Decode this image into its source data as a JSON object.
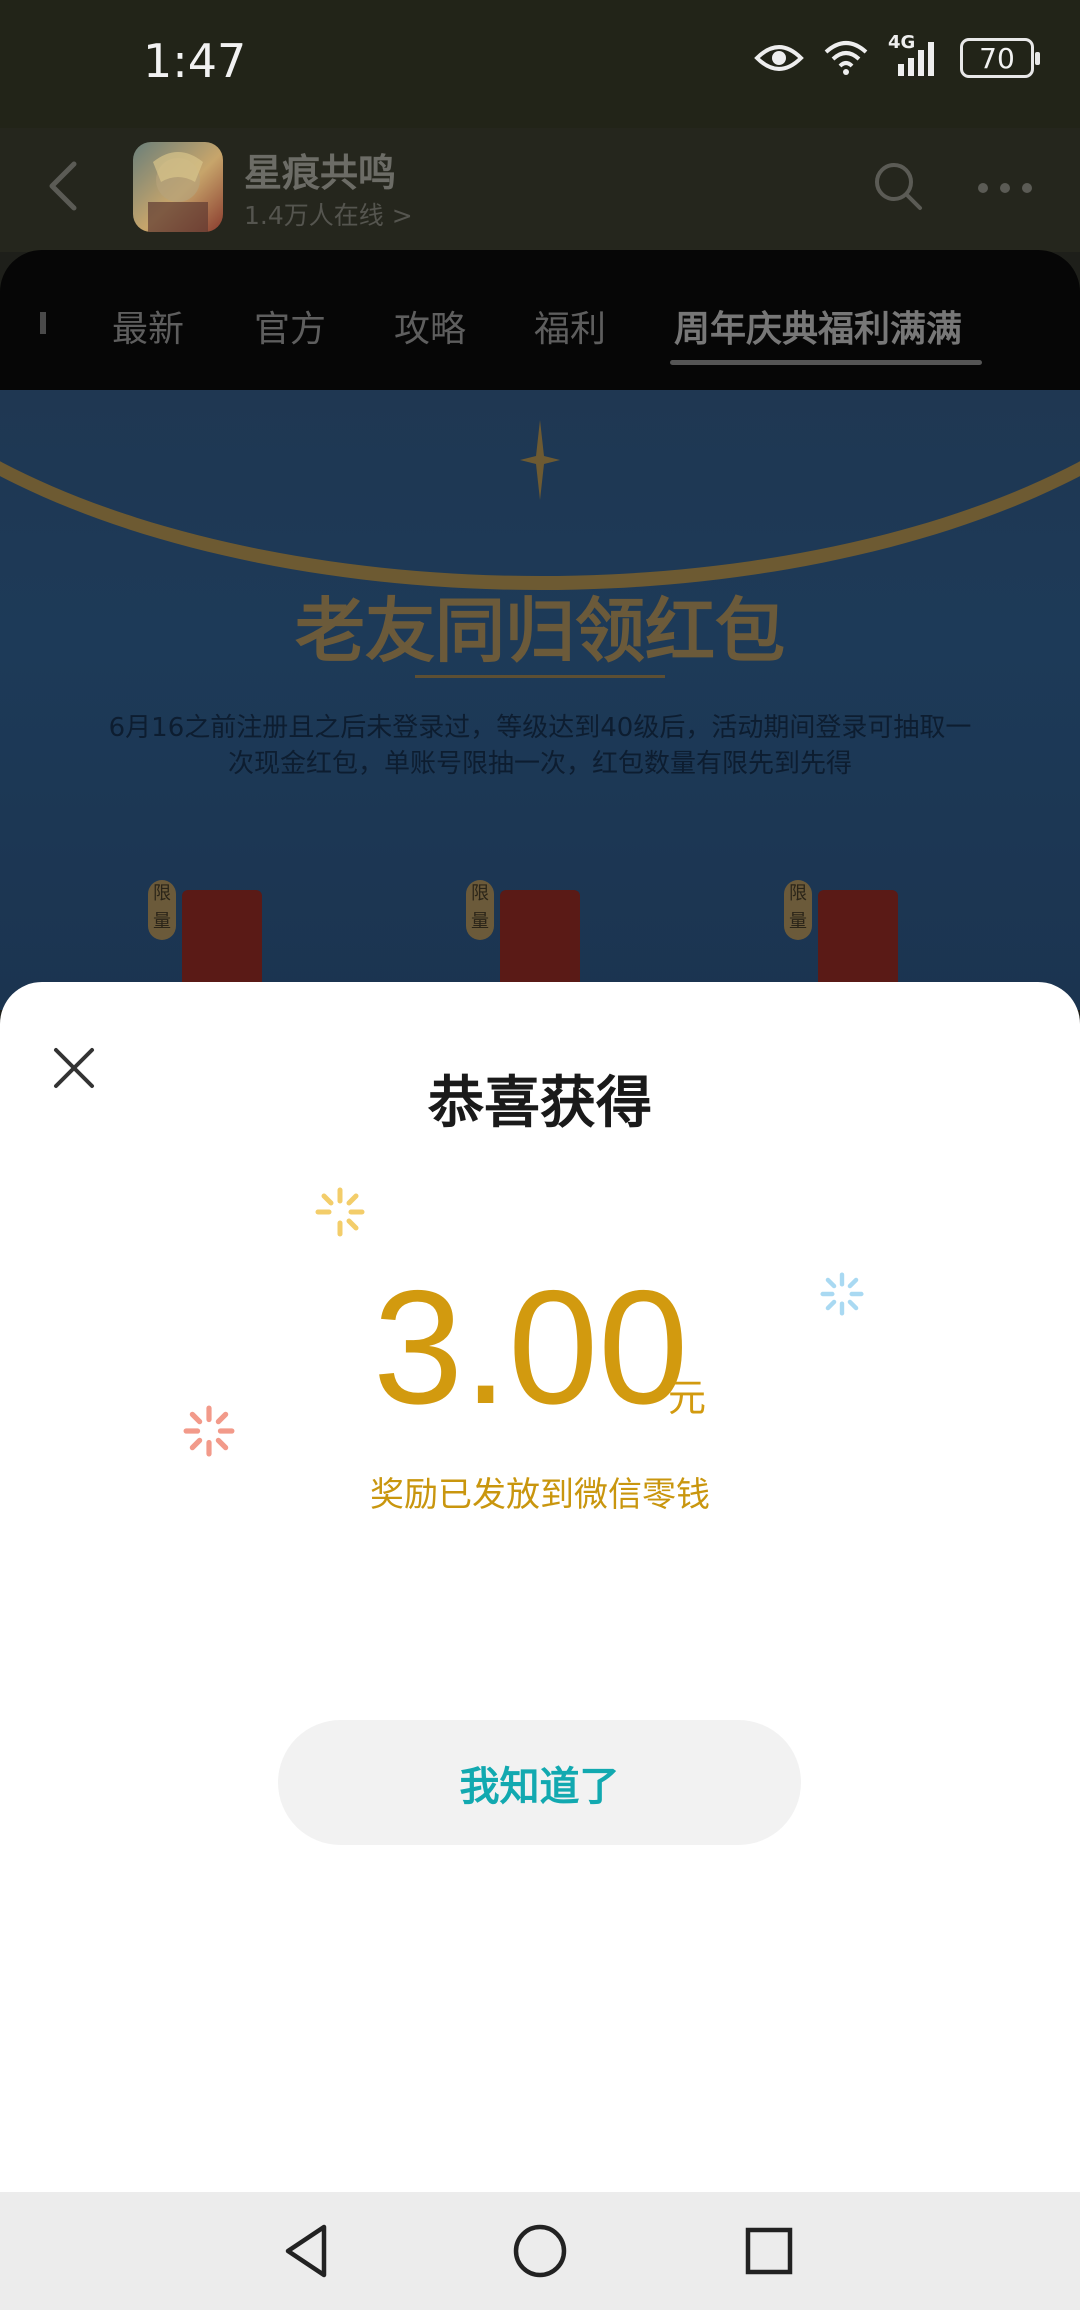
{
  "status": {
    "time": "1:47",
    "battery": "70",
    "network": "4G"
  },
  "header": {
    "title": "星痕共鸣",
    "subtitle": "1.4万人在线 >"
  },
  "tabs": [
    {
      "label": "最新"
    },
    {
      "label": "官方"
    },
    {
      "label": "攻略"
    },
    {
      "label": "福利"
    },
    {
      "label": "周年庆典福利满满",
      "active": true
    }
  ],
  "banner": {
    "heading": "老友同归领红包",
    "description": "6月16之前注册且之后未登录过，等级达到40级后，活动期间登录可抽取一次现金红包，单账号限抽一次，红包数量有限先到先得",
    "badge": "限量"
  },
  "dialog": {
    "title": "恭喜获得",
    "amount": "3.00",
    "unit": "元",
    "message": "奖励已发放到微信零钱",
    "confirm_label": "我知道了"
  },
  "colors": {
    "accent_gold": "#d29a0f",
    "button_teal": "#12a9b0"
  },
  "icons": {
    "header": [
      "back-arrow-icon",
      "search-icon",
      "more-icon"
    ],
    "nav": [
      "back-triangle-icon",
      "home-circle-icon",
      "recents-square-icon"
    ]
  }
}
